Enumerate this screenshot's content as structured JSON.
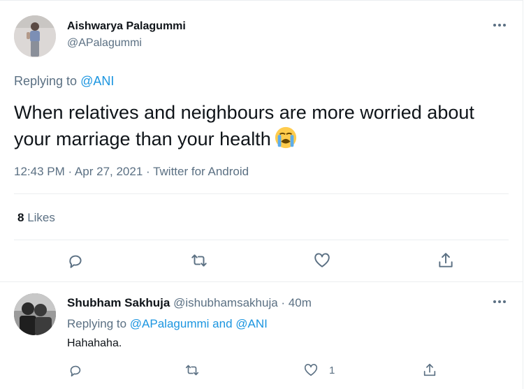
{
  "main_tweet": {
    "author_name": "Aishwarya Palagummi",
    "author_handle": "@APalagummi",
    "replying_prefix": "Replying to",
    "replying_to": "@ANI",
    "text": "When relatives and neighbours are more worried about your marriage than your health",
    "emoji_icon": "loudly-crying-face-emoji",
    "timestamp": "12:43 PM · Apr 27, 2021 · Twitter for Android",
    "likes_count": "8",
    "likes_label": "Likes"
  },
  "reply_tweet": {
    "author_name": "Shubham Sakhuja",
    "author_handle": "@ishubhamsakhuja",
    "time_ago": "· 40m",
    "replying_prefix": "Replying to",
    "replying_to_1": "@APalagummi",
    "replying_and": "and",
    "replying_to_2": "@ANI",
    "text": "Hahahaha.",
    "like_count": "1"
  },
  "icons": {
    "reply": "reply-icon",
    "retweet": "retweet-icon",
    "like": "heart-icon",
    "share": "share-icon",
    "more": "more-icon"
  },
  "colors": {
    "text": "#0f1419",
    "secondary": "#5b7083",
    "link": "#1b95e0",
    "divider": "#ebeef0"
  }
}
